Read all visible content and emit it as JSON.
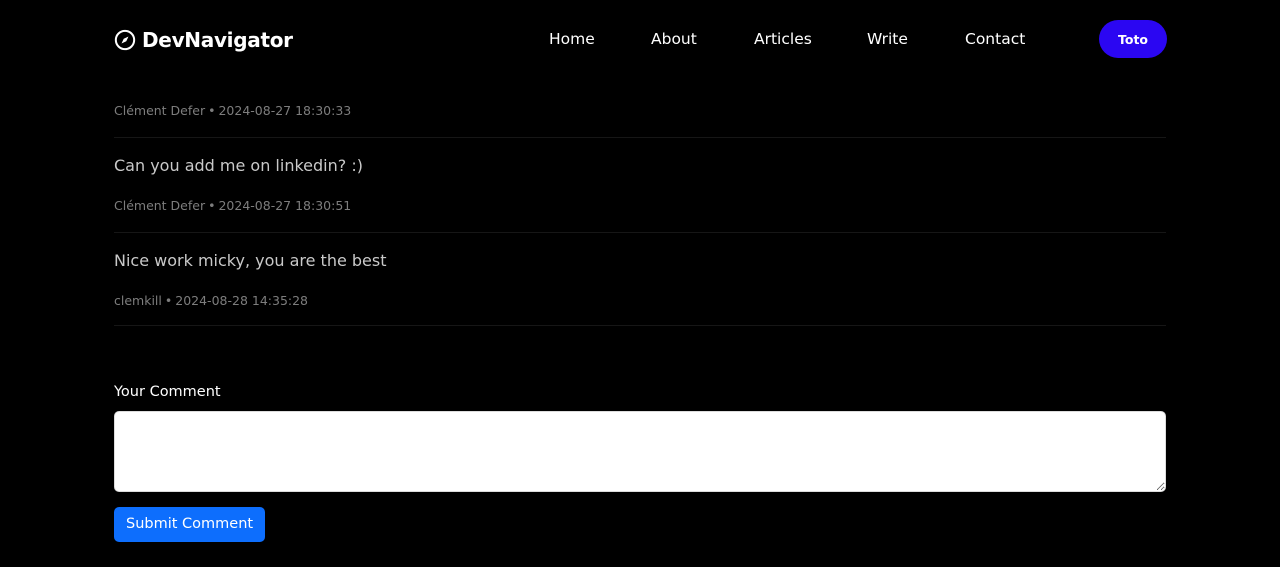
{
  "header": {
    "brand": "DevNavigator",
    "brand_icon": "compass-icon",
    "nav": [
      {
        "label": "Home"
      },
      {
        "label": "About"
      },
      {
        "label": "Articles"
      },
      {
        "label": "Write"
      },
      {
        "label": "Contact"
      }
    ],
    "user_button": "Toto",
    "user_button_color": "#2b06f2"
  },
  "comments": [
    {
      "text": "",
      "author": "Clément Defer",
      "separator": "•",
      "date": "2024-08-27 18:30:33"
    },
    {
      "text": "Can you add me on linkedin? :)",
      "author": "Clément Defer",
      "separator": "•",
      "date": "2024-08-27 18:30:51"
    },
    {
      "text": "Nice work micky, you are the best",
      "author": "clemkill",
      "separator": "•",
      "date": "2024-08-28 14:35:28"
    }
  ],
  "form": {
    "label": "Your Comment",
    "textarea_value": "",
    "submit_label": "Submit Comment",
    "submit_color": "#0d6efd"
  }
}
